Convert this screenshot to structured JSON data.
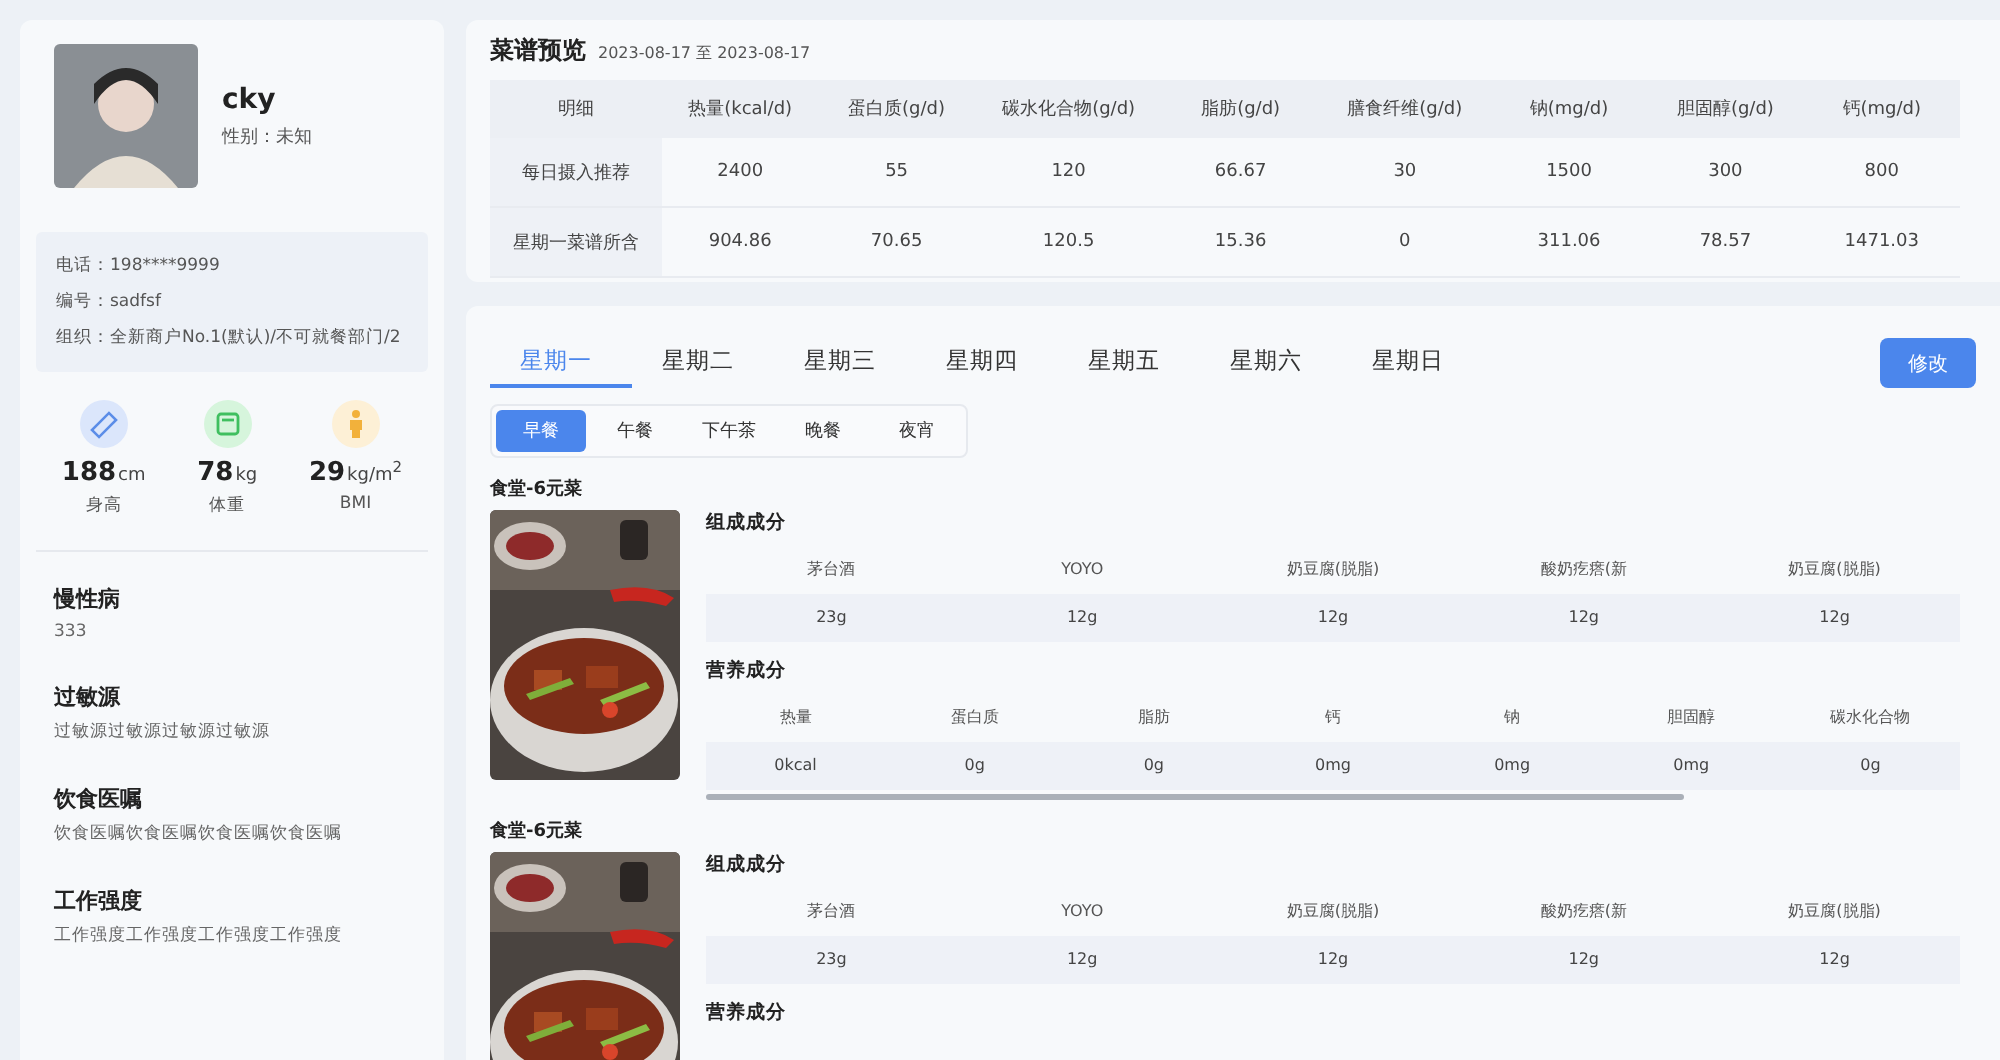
{
  "profile": {
    "name": "cky",
    "gender": "性别：未知",
    "phone": "电话：198****9999",
    "code": "编号：sadfsf",
    "org": "组织：全新商户No.1(默认)/不可就餐部门/2",
    "stats": [
      {
        "kind": "height",
        "value": "188",
        "unit": "cm",
        "label": "身高"
      },
      {
        "kind": "weight",
        "value": "78",
        "unit": "kg",
        "label": "体重"
      },
      {
        "kind": "bmi",
        "value": "29",
        "unit": "kg/m$^{2}$",
        "label": "BMI"
      }
    ],
    "sections": [
      {
        "title": "慢性病",
        "text": "333"
      },
      {
        "title": "过敏源",
        "text": "过敏源过敏源过敏源过敏源"
      },
      {
        "title": "饮食医嘱",
        "text": "饮食医嘱饮食医嘱饮食医嘱饮食医嘱"
      },
      {
        "title": "工作强度",
        "text": "工作强度工作强度工作强度工作强度"
      }
    ]
  },
  "preview": {
    "title": "菜谱预览",
    "range": "2023-08-17 至 2023-08-17",
    "columns": [
      "明细",
      "热量(kcal/d)",
      "蛋白质(g/d)",
      "碳水化合物(g/d)",
      "脂肪(g/d)",
      "膳食纤维(g/d)",
      "钠(mg/d)",
      "胆固醇(g/d)",
      "钙(mg/d)"
    ],
    "rows": [
      [
        "每日摄入推荐",
        "2400",
        "55",
        "120",
        "66.67",
        "30",
        "1500",
        "300",
        "800"
      ],
      [
        "星期一菜谱所含",
        "904.86",
        "70.65",
        "120.5",
        "15.36",
        "0",
        "311.06",
        "78.57",
        "1471.03"
      ]
    ]
  },
  "days": [
    {
      "label": "星期一",
      "selected": true
    },
    {
      "label": "星期二",
      "selected": false
    },
    {
      "label": "星期三",
      "selected": false
    },
    {
      "label": "星期四",
      "selected": false
    },
    {
      "label": "星期五",
      "selected": false
    },
    {
      "label": "星期六",
      "selected": false
    },
    {
      "label": "星期日",
      "selected": false
    }
  ],
  "edit_button": "修改",
  "meals": [
    {
      "label": "早餐",
      "selected": true
    },
    {
      "label": "午餐",
      "selected": false
    },
    {
      "label": "下午茶",
      "selected": false
    },
    {
      "label": "晚餐",
      "selected": false
    },
    {
      "label": "夜宵",
      "selected": false
    }
  ],
  "dishes": [
    {
      "name": "食堂-6元菜",
      "ingredients": {
        "title": "组成成分",
        "columns": [
          "茅台酒",
          "YOYO",
          "奶豆腐(脱脂)",
          "酸奶疙瘩(新",
          "奶豆腐(脱脂)"
        ],
        "values": [
          "23g",
          "12g",
          "12g",
          "12g",
          "12g"
        ]
      },
      "nutrition": {
        "title": "营养成分",
        "columns": [
          "热量",
          "蛋白质",
          "脂肪",
          "钙",
          "钠",
          "胆固醇",
          "碳水化合物"
        ],
        "values": [
          "0kcal",
          "0g",
          "0g",
          "0mg",
          "0mg",
          "0mg",
          "0g"
        ]
      }
    },
    {
      "name": "食堂-6元菜",
      "ingredients": {
        "title": "组成成分",
        "columns": [
          "茅台酒",
          "YOYO",
          "奶豆腐(脱脂)",
          "酸奶疙瘩(新",
          "奶豆腐(脱脂)"
        ],
        "values": [
          "23g",
          "12g",
          "12g",
          "12g",
          "12g"
        ]
      },
      "nutrition": {
        "title": "营养成分"
      }
    }
  ]
}
